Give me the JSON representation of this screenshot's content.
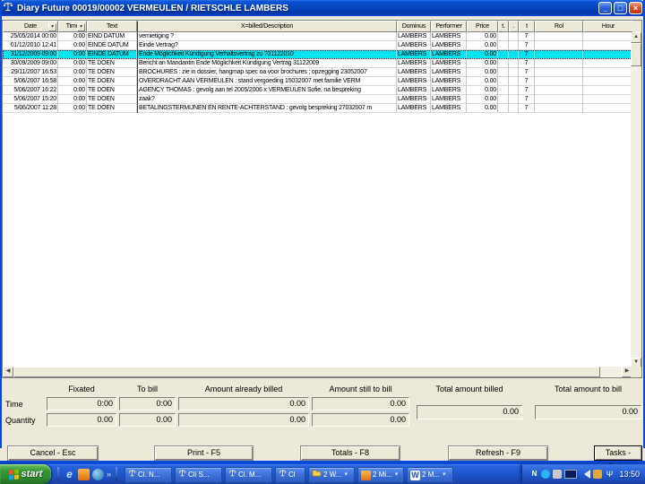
{
  "window": {
    "title": "Diary Future 00019/00002 VERMEULEN / RIETSCHLE LAMBERS"
  },
  "icons": {
    "minimize": "_",
    "maximize": "□",
    "close": "×",
    "sort": "▼",
    "scroll_up": "▲",
    "scroll_down": "▼",
    "scroll_left": "◀",
    "scroll_right": "▶",
    "dropdown": "▾",
    "overflow": "»",
    "ie": "e",
    "word": "W",
    "msn": "N",
    "wifi": "Ψ"
  },
  "colors": {
    "titlebar_blue": "#0A49D6",
    "selected_row_cyan": "#00E3F0",
    "window_bg": "#ECE9D8",
    "taskbar_blue": "#245EDC",
    "start_green": "#379637"
  },
  "grid": {
    "columns": {
      "date": "Date",
      "time": "Time",
      "text": "Text",
      "description": "X=billed/Description",
      "dominus": "Dominus",
      "performer": "Performer",
      "price": "Price",
      "flag1": "t.",
      "flag2": ".",
      "flag3": "t",
      "rol": "Rol",
      "hour": "Hour"
    },
    "rows": [
      {
        "date": "25/05/2014 00:00",
        "time": "0:00",
        "text": "EIND DATUM",
        "description": "vernietiging ?",
        "dominus": "LAMBERS",
        "performer": "LAMBERS",
        "price": "0.00",
        "flag1": "",
        "flag2": "",
        "flag3": "7",
        "rol": "",
        "hour": "",
        "selected": false
      },
      {
        "date": "01/12/2010 12:41",
        "time": "0:00",
        "text": "EINDE DATUM",
        "description": "Einde Vertrag?",
        "dominus": "LAMBERS",
        "performer": "LAMBERS",
        "price": "0.00",
        "flag1": "",
        "flag2": "",
        "flag3": "7",
        "rol": "",
        "hour": "",
        "selected": false
      },
      {
        "date": "31/12/2009 09:00",
        "time": "0:00",
        "text": "EINDE DATUM",
        "description": "Ende Möglichkeit Kündigung Verhaltsvertrag zu ?31122010",
        "dominus": "LAMBERS",
        "performer": "LAMBERS",
        "price": "0.00",
        "flag1": "",
        "flag2": "",
        "flag3": "7",
        "rol": "",
        "hour": "",
        "selected": true
      },
      {
        "date": "30/09/2009 09:00",
        "time": "0:00",
        "text": "TE DOEN",
        "description": "Bericht an Mandantin Ende Möglichkeit Kündigung Vertrag 31122009",
        "dominus": "LAMBERS",
        "performer": "LAMBERS",
        "price": "0.00",
        "flag1": "",
        "flag2": "",
        "flag3": "7",
        "rol": "",
        "hour": "",
        "selected": false
      },
      {
        "date": "29/11/2007 16:53",
        "time": "0:00",
        "text": "TE DOEN",
        "description": "BROCHURES : zie in dossier, hangmap spec oa voor brochures ; opzegging 23052007",
        "dominus": "LAMBERS",
        "performer": "LAMBERS",
        "price": "0.00",
        "flag1": "",
        "flag2": "",
        "flag3": "7",
        "rol": "",
        "hour": "",
        "selected": false
      },
      {
        "date": "5/06/2007 16:58",
        "time": "0:00",
        "text": "TE DOEN",
        "description": "OVERDRACHT AAN VERMEULEN : stand vergoeding 15032007 met familie VERM",
        "dominus": "LAMBERS",
        "performer": "LAMBERS",
        "price": "0.00",
        "flag1": "",
        "flag2": "",
        "flag3": "7",
        "rol": "",
        "hour": "",
        "selected": false
      },
      {
        "date": "5/06/2007 16:22",
        "time": "0:00",
        "text": "TE DOEN",
        "description": "AGENCY THOMAS : gevolg aan tel 2005/2006 x VERMEULEN Sofie, na bespreking",
        "dominus": "LAMBERS",
        "performer": "LAMBERS",
        "price": "0.00",
        "flag1": "",
        "flag2": "",
        "flag3": "7",
        "rol": "",
        "hour": "",
        "selected": false
      },
      {
        "date": "5/06/2007 15:20",
        "time": "0:00",
        "text": "TE DOEN",
        "description": "zaak?",
        "dominus": "LAMBERS",
        "performer": "LAMBERS",
        "price": "0.00",
        "flag1": "",
        "flag2": "",
        "flag3": "7",
        "rol": "",
        "hour": "",
        "selected": false
      },
      {
        "date": "5/06/2007 11:28",
        "time": "0:00",
        "text": "TE DOEN",
        "description": "BETALINGSTERMIJNEN EN RENTE-ACHTERSTAND : gevolg bespreking 27032007 m",
        "dominus": "LAMBERS",
        "performer": "LAMBERS",
        "price": "0.00",
        "flag1": "",
        "flag2": "",
        "flag3": "7",
        "rol": "",
        "hour": "",
        "selected": false
      }
    ]
  },
  "summary": {
    "col_labels": [
      "Fixated",
      "To bill",
      "Amount already billed",
      "Amount still to bill",
      "Total amount billed",
      "Total amount to bill"
    ],
    "row_labels": [
      "Time",
      "Quantity"
    ],
    "time_row": [
      "0:00",
      "0:00",
      "0.00",
      "0.00"
    ],
    "quantity_row": [
      "0.00",
      "0.00",
      "0.00",
      "0.00"
    ],
    "totals": {
      "billed": "0.00",
      "to_bill": "0.00"
    }
  },
  "actions": [
    "Cancel - Esc",
    "Print - F5",
    "Totals - F8",
    "Refresh - F9",
    "Tasks - Enter"
  ],
  "taskbar": {
    "start_label": "start",
    "tasks": [
      {
        "icon": "scales-icon",
        "label": "Cl. N..."
      },
      {
        "icon": "scales-icon",
        "label": "Cli S..."
      },
      {
        "icon": "scales-icon",
        "label": "Cl. M..."
      },
      {
        "icon": "scales-icon",
        "label": "Cl"
      },
      {
        "icon": "folder-icon",
        "label": "2 W..."
      },
      {
        "icon": "mail-icon",
        "label": "2 Mi..."
      },
      {
        "icon": "word-icon",
        "label": "2 M..."
      }
    ],
    "clock": "13:50"
  }
}
